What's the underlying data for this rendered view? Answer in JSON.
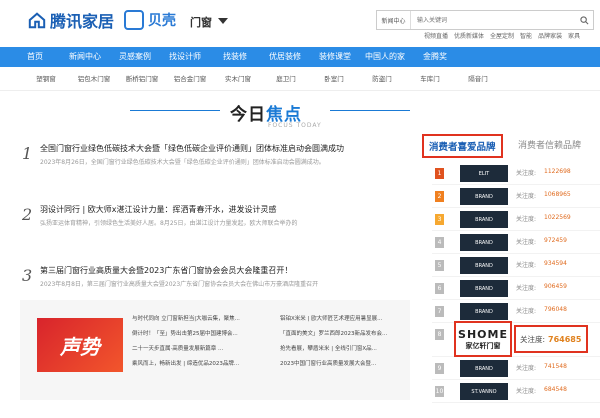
{
  "header": {
    "logo_text": "腾讯家居",
    "sub_logo_text": "贝壳",
    "channel": "门窗",
    "search_select": "新闻中心",
    "search_placeholder": "输入关键词",
    "quick_links": [
      "视频直播",
      "优质新媒体",
      "全屋定制",
      "智能",
      "品牌家装",
      "家具"
    ]
  },
  "nav": {
    "items": [
      "首页",
      "新闻中心",
      "灵感案例",
      "找设计师",
      "找装修",
      "优居装修",
      "装修课堂",
      "中国人的家",
      "金腾奖"
    ]
  },
  "subnav": {
    "items": [
      "塑钢窗",
      "铝包木门窗",
      "断桥铝门窗",
      "铝合金门窗",
      "实木门窗",
      "庭卫门",
      "卧室门",
      "防盗门",
      "车库门",
      "隔音门"
    ]
  },
  "section": {
    "title_plain": "今日",
    "title_accent": "焦点",
    "title_en": "FOCUS TODAY"
  },
  "articles": [
    {
      "num": "1",
      "title": "全国门窗行业绿色低碳技术大会暨「绿色低碳企业评价通则」团体标准启动会圆满成功",
      "desc": "2023年8月26日，全国门窗行业绿色低碳技术大会暨「绿色低碳企业评价通则」团体标准启动会圆满成功。"
    },
    {
      "num": "2",
      "title": "羽设计同行 | 欧大师x湛江设计力量：挥洒青春汗水，进发设计灵感",
      "desc": "弘扬亚运体育精神，引领绿色生活美好人居。8月25日，由湛江设计力量发起，欧大师联合举办的"
    },
    {
      "num": "3",
      "title": "第三届门窗行业高质量大会暨2023广东省门窗协会会员大会隆重召开！",
      "desc": "2023年8月8日，第三届门窗行业高质量大会暨2023广东省门窗协会会员大会在佛山市万豪酒店隆重召开"
    }
  ],
  "promo": {
    "image_text": "声势",
    "col1": [
      "与时代同向 立门窗新担当|大咖云集，聚焦...",
      "倒计时！「至」势出击第25届中国建博会...",
      "二十一天步直属·高质量发展新篇章 ...",
      "乘风而上，畅新出发 | 缔造优品2023品牌..."
    ],
    "col2": [
      "铝铂X米米 | 欧大师匠艺术理应用暑显展...",
      "「直面的美文」罗兰西郎2023新品发布会...",
      "抢先看展，攀盾米米 | 全线引门窗X品...",
      "2023中国门窗行业高质量发展大会暨..."
    ]
  },
  "ranking": {
    "tab_active": "消费者喜爱品牌",
    "tab_other": "消费者信赖品牌",
    "attn_label": "关注度:",
    "rows": [
      {
        "num": "1",
        "logo": "ELIT",
        "value": "1122698",
        "num_color": "#e0521f"
      },
      {
        "num": "2",
        "logo": "BRAND",
        "value": "1068965",
        "num_color": "#f08020"
      },
      {
        "num": "3",
        "logo": "BRAND",
        "value": "1022569",
        "num_color": "#f6a830"
      },
      {
        "num": "4",
        "logo": "BRAND",
        "value": "972459",
        "num_color": "#bbb"
      },
      {
        "num": "5",
        "logo": "BRAND",
        "value": "934594",
        "num_color": "#bbb"
      },
      {
        "num": "6",
        "logo": "BRAND",
        "value": "906459",
        "num_color": "#bbb"
      },
      {
        "num": "7",
        "logo": "BRAND",
        "value": "796048",
        "num_color": "#bbb"
      }
    ],
    "highlight": {
      "num": "8",
      "logo_line1": "SHOME",
      "logo_line2": "家亿轩门窗",
      "value": "764685"
    },
    "rows_after": [
      {
        "num": "9",
        "logo": "BRAND",
        "value": "741548",
        "num_color": "#bbb"
      },
      {
        "num": "10",
        "logo": "ST.VANNO",
        "value": "684548",
        "num_color": "#bbb"
      }
    ]
  }
}
